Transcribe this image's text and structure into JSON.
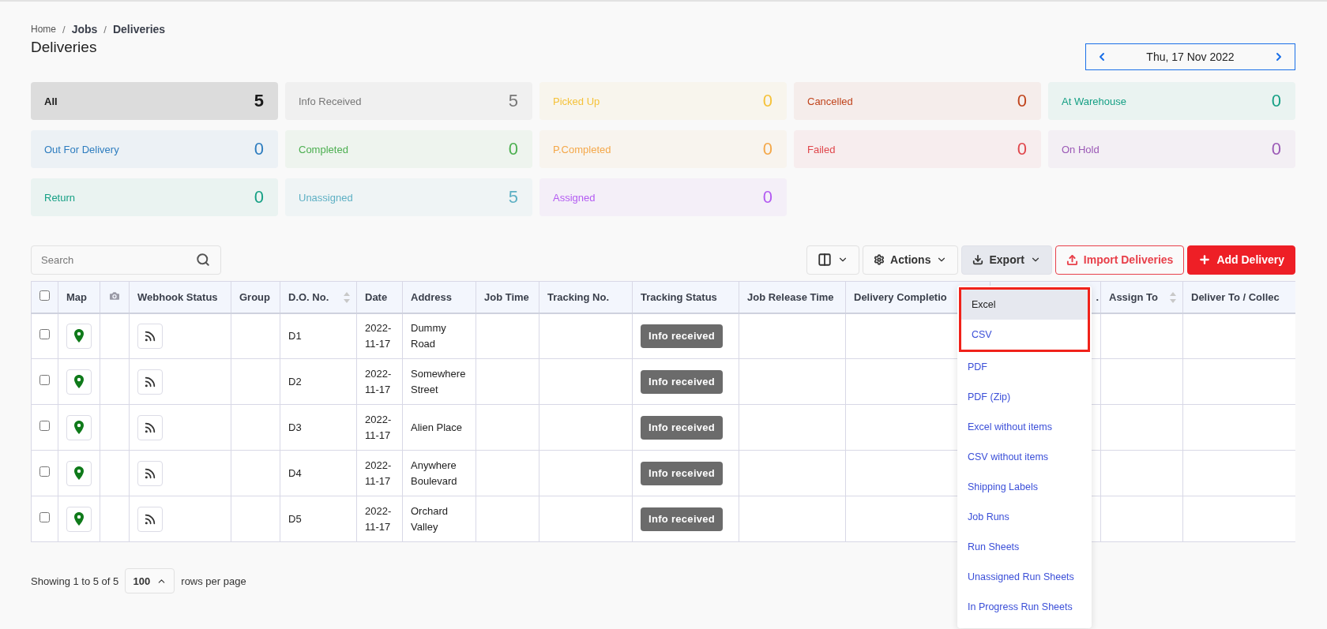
{
  "breadcrumb": [
    {
      "label": "Home",
      "current": false
    },
    {
      "separator": "/",
      "label": "Jobs",
      "current": true
    },
    {
      "separator": "/",
      "label": "Deliveries",
      "current": true
    }
  ],
  "title": "Deliveries",
  "date_picker": {
    "value": "Thu, 17 Nov 2022"
  },
  "status_cards": [
    {
      "label": "All",
      "count": "5",
      "color": "#1a1a1a",
      "selected": true
    },
    {
      "label": "Info Received",
      "count": "5",
      "color": "#777777",
      "selected": false
    },
    {
      "label": "Picked Up",
      "count": "0",
      "color": "#f5c23a",
      "selected": false
    },
    {
      "label": "Cancelled",
      "count": "0",
      "color": "#c0441c",
      "selected": false
    },
    {
      "label": "At Warehouse",
      "count": "0",
      "color": "#16a085",
      "selected": false
    },
    {
      "label": "Out For Delivery",
      "count": "0",
      "color": "#2e7dbf",
      "selected": false
    },
    {
      "label": "Completed",
      "count": "0",
      "color": "#4caf50",
      "selected": false
    },
    {
      "label": "P.Completed",
      "count": "0",
      "color": "#f4a84a",
      "selected": false
    },
    {
      "label": "Failed",
      "count": "0",
      "color": "#e0474c",
      "selected": false
    },
    {
      "label": "On Hold",
      "count": "0",
      "color": "#9b59b6",
      "selected": false
    },
    {
      "label": "Return",
      "count": "0",
      "color": "#16a085",
      "selected": false
    },
    {
      "label": "Unassigned",
      "count": "5",
      "color": "#5eb0c4",
      "selected": false
    },
    {
      "label": "Assigned",
      "count": "0",
      "color": "#b35bf2",
      "selected": false
    }
  ],
  "search": {
    "placeholder": "Search"
  },
  "toolbar": {
    "actions": "Actions",
    "export": "Export",
    "import": "Import Deliveries",
    "add": "Add Delivery"
  },
  "table": {
    "all_selected": false,
    "columns": [
      {
        "kind": "checkbox"
      },
      {
        "kind": "text",
        "label": "Map"
      },
      {
        "kind": "camera"
      },
      {
        "kind": "text",
        "label": "Webhook Status"
      },
      {
        "kind": "text",
        "label": "Group"
      },
      {
        "kind": "text",
        "label": "D.O. No.",
        "sortable": true
      },
      {
        "kind": "text",
        "label": "Date"
      },
      {
        "kind": "text",
        "label": "Address"
      },
      {
        "kind": "text",
        "label": "Job Time"
      },
      {
        "kind": "text",
        "label": "Tracking No."
      },
      {
        "kind": "text",
        "label": "Tracking Status"
      },
      {
        "kind": "text",
        "label": "Job Release Time"
      },
      {
        "kind": "text",
        "label": "Delivery Completio"
      },
      {
        "kind": "end",
        "label": "."
      },
      {
        "kind": "text",
        "label": "Assign To",
        "sortable": true
      },
      {
        "kind": "text",
        "label": "Deliver To / Collec"
      }
    ],
    "rows": [
      {
        "checked": false,
        "do_no": "D1",
        "date": "2022-11-17",
        "address": "Dummy Road",
        "status": "Info received"
      },
      {
        "checked": false,
        "do_no": "D2",
        "date": "2022-11-17",
        "address": "Somewhere Street",
        "status": "Info received"
      },
      {
        "checked": false,
        "do_no": "D3",
        "date": "2022-11-17",
        "address": "Alien Place",
        "status": "Info received"
      },
      {
        "checked": false,
        "do_no": "D4",
        "date": "2022-11-17",
        "address": "Anywhere Boulevard",
        "status": "Info received"
      },
      {
        "checked": false,
        "do_no": "D5",
        "date": "2022-11-17",
        "address": "Orchard Valley",
        "status": "Info received"
      }
    ]
  },
  "footer": {
    "showing": "Showing 1 to 5 of 5",
    "page_size": "100",
    "suffix": "rows per page"
  },
  "export_menu": {
    "items": [
      {
        "label": "Excel",
        "selected": true,
        "highlighted": true
      },
      {
        "label": "CSV",
        "selected": false,
        "highlighted": true
      },
      {
        "label": "PDF",
        "selected": false,
        "highlighted": false
      },
      {
        "label": "PDF (Zip)",
        "selected": false,
        "highlighted": false
      },
      {
        "label": "Excel without items",
        "selected": false,
        "highlighted": false
      },
      {
        "label": "CSV without items",
        "selected": false,
        "highlighted": false
      },
      {
        "label": "Shipping Labels",
        "selected": false,
        "highlighted": false
      },
      {
        "label": "Job Runs",
        "selected": false,
        "highlighted": false
      },
      {
        "label": "Run Sheets",
        "selected": false,
        "highlighted": false
      },
      {
        "label": "Unassigned Run Sheets",
        "selected": false,
        "highlighted": false
      },
      {
        "label": "In Progress Run Sheets",
        "selected": false,
        "highlighted": false
      }
    ]
  }
}
